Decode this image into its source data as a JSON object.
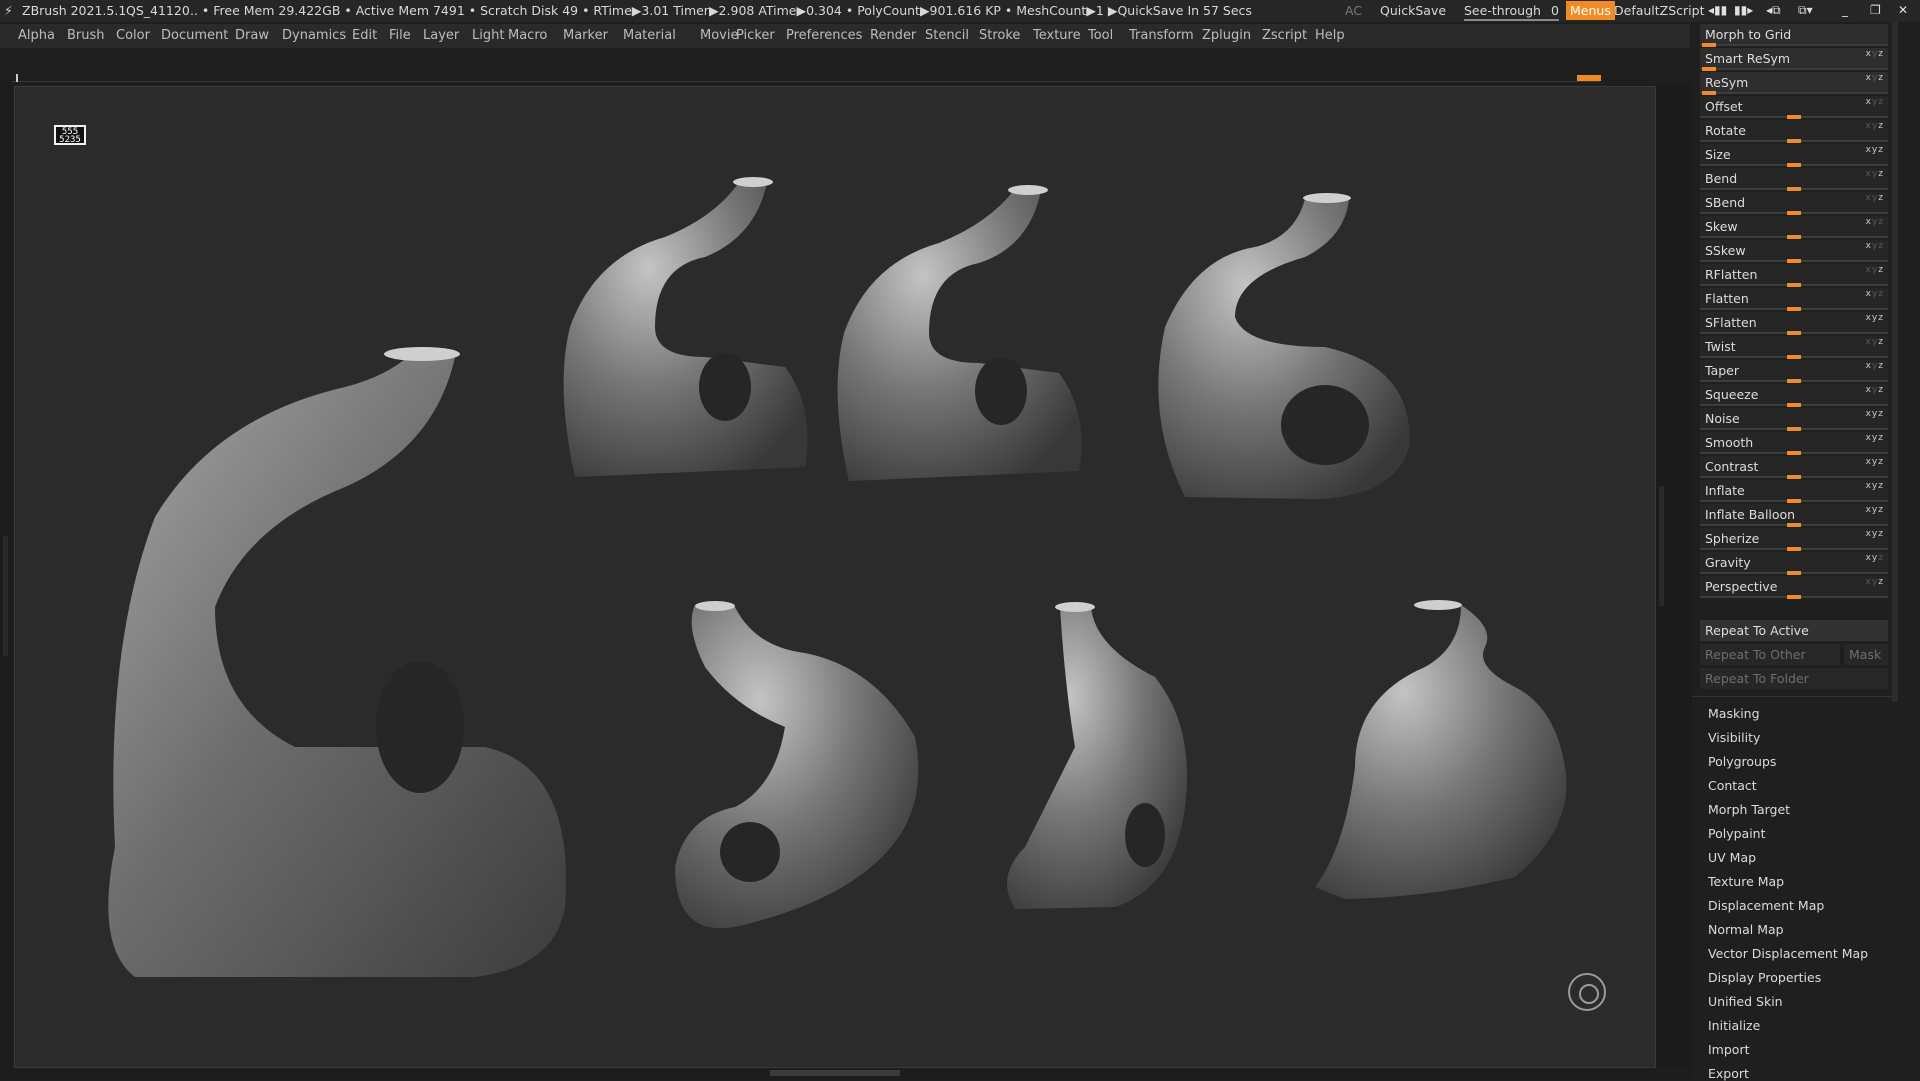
{
  "titlebar": {
    "app": "ZBrush 2021.5.1",
    "doc": "QS_41120",
    "stats": ".. • Free Mem 29.422GB • Active Mem 7491 • Scratch Disk 49 • RTime▶3.01 Timer▶2.908 ATime▶0.304 • PolyCount▶901.616 KP • MeshCount▶1 ▶QuickSave In 57 Secs",
    "ac": "AC",
    "quicksave": "QuickSave",
    "seethrough": "See-through",
    "seethrough_value": "0",
    "menus": "Menus",
    "script": "DefaultZScript"
  },
  "menubar": [
    "Alpha",
    "Brush",
    "Color",
    "Document",
    "Draw",
    "Dynamics",
    "Edit",
    "File",
    "Layer",
    "Light",
    "Macro",
    "Marker",
    "Material",
    "Movie",
    "Picker",
    "Preferences",
    "Render",
    "Stencil",
    "Stroke",
    "Texture",
    "Tool",
    "Transform",
    "Zplugin",
    "Zscript",
    "Help"
  ],
  "viewport": {
    "thumbnail_text": "555 5235",
    "colors": {
      "bg": "#2b2b2b",
      "mesh": "#8c8c8c",
      "accent": "#f08a24"
    }
  },
  "panel": {
    "top_items": [
      {
        "label": "Morph to Grid"
      },
      {
        "label": "Smart ReSym"
      },
      {
        "label": "ReSym"
      }
    ],
    "deformers": [
      {
        "label": "Offset",
        "axes": "x"
      },
      {
        "label": "Rotate",
        "axes": "z"
      },
      {
        "label": "Size",
        "axes": "xyz"
      },
      {
        "label": "Bend",
        "axes": "z"
      },
      {
        "label": "SBend",
        "axes": "z"
      },
      {
        "label": "Skew",
        "axes": "x"
      },
      {
        "label": "SSkew",
        "axes": "x"
      },
      {
        "label": "RFlatten",
        "axes": "z"
      },
      {
        "label": "Flatten",
        "axes": "x"
      },
      {
        "label": "SFlatten",
        "axes": "xyz"
      },
      {
        "label": "Twist",
        "axes": "z"
      },
      {
        "label": "Taper",
        "axes": "xz"
      },
      {
        "label": "Squeeze",
        "axes": "xz"
      },
      {
        "label": "Noise",
        "axes": "xyz"
      },
      {
        "label": "Smooth",
        "axes": "xyz"
      },
      {
        "label": "Contrast",
        "axes": "xyz"
      },
      {
        "label": "Inflate",
        "axes": "xyz"
      },
      {
        "label": "Inflate Balloon",
        "axes": "xyz"
      },
      {
        "label": "Spherize",
        "axes": "xyz"
      },
      {
        "label": "Gravity",
        "axes": "xy"
      },
      {
        "label": "Perspective",
        "axes": "z"
      }
    ],
    "repeat": {
      "active": "Repeat To Active",
      "other": "Repeat To Other",
      "mask": "Mask",
      "folder": "Repeat To Folder"
    },
    "subpalettes": [
      "Masking",
      "Visibility",
      "Polygroups",
      "Contact",
      "Morph Target",
      "Polypaint",
      "UV Map",
      "Texture Map",
      "Displacement Map",
      "Normal Map",
      "Vector Displacement Map",
      "Display Properties",
      "Unified Skin",
      "Initialize",
      "Import",
      "Export"
    ]
  }
}
